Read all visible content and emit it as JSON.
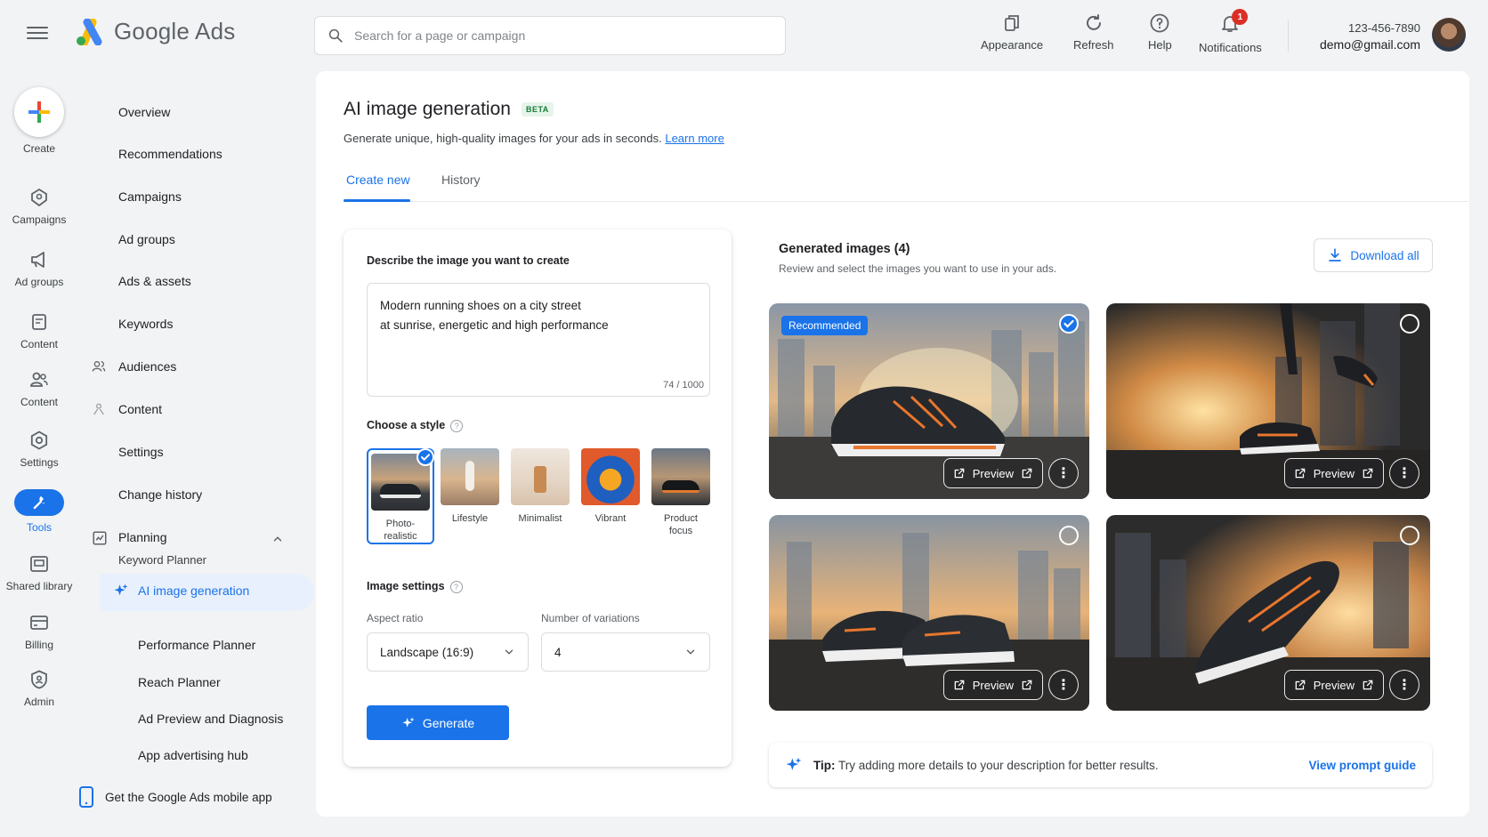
{
  "app": {
    "name": "Google Ads"
  },
  "search": {
    "placeholder": "Search for a page or campaign"
  },
  "toolbar": {
    "appearance": "Appearance",
    "refresh": "Refresh",
    "help": "Help",
    "notifications": "Notifications",
    "notification_count": "1"
  },
  "account": {
    "phone": "123-456-7890",
    "email": "demo@gmail.com"
  },
  "rail": {
    "create": "Create",
    "items": [
      "Campaigns",
      "Ad groups",
      "Content",
      "Content",
      "Settings",
      "Tools",
      "Shared library",
      "Billing",
      "Admin"
    ]
  },
  "nav": {
    "items": [
      "Overview",
      "Recommendations",
      "Campaigns",
      "Ad groups",
      "Ads & assets",
      "Keywords",
      "Audiences",
      "Content",
      "Settings",
      "Change history",
      "Planning"
    ],
    "planning_sub": [
      "Keyword Planner",
      "AI image generation",
      "Performance Planner",
      "Reach Planner",
      "Ad Preview and Diagnosis",
      "App advertising hub"
    ],
    "mobile_app": "Get the Google Ads mobile app"
  },
  "page": {
    "title": "AI image generation",
    "badge": "BETA",
    "subtitle": "Generate unique, high-quality images for your ads in seconds.",
    "learn_more": "Learn more",
    "tabs": [
      "Create new",
      "History"
    ]
  },
  "form": {
    "describe_label": "Describe the image you want to create",
    "prompt": "Modern running shoes on a city street\nat sunrise, energetic and high performance",
    "char_count": "74 / 1000",
    "style_label": "Choose a style",
    "styles": [
      "Photo-\nrealistic",
      "Lifestyle",
      "Minimalist",
      "Vibrant",
      "Product\nfocus"
    ],
    "selected_style": "Photo-realistic",
    "settings_label": "Image settings",
    "aspect_label": "Aspect ratio",
    "aspect_value": "Landscape (16:9)",
    "variations_label": "Number of variations",
    "variations_value": "4",
    "generate": "Generate"
  },
  "results": {
    "title": "Generated images (4)",
    "subtitle": "Review and select the images you want to use in your ads.",
    "download_all": "Download all",
    "recommended": "Recommended",
    "preview": "Preview",
    "images": [
      {
        "subject": "shoe-side",
        "selected": true
      },
      {
        "subject": "runner-feet",
        "selected": false
      },
      {
        "subject": "shoe-pair",
        "selected": false
      },
      {
        "subject": "shoe-angle",
        "selected": false
      }
    ]
  },
  "tip": {
    "label": "Tip:",
    "text": "Try adding more details to your description for better results.",
    "link": "View prompt guide"
  },
  "colors": {
    "accent": "#1a73e8",
    "badge_red": "#d93025",
    "beta_green": "#188038"
  }
}
